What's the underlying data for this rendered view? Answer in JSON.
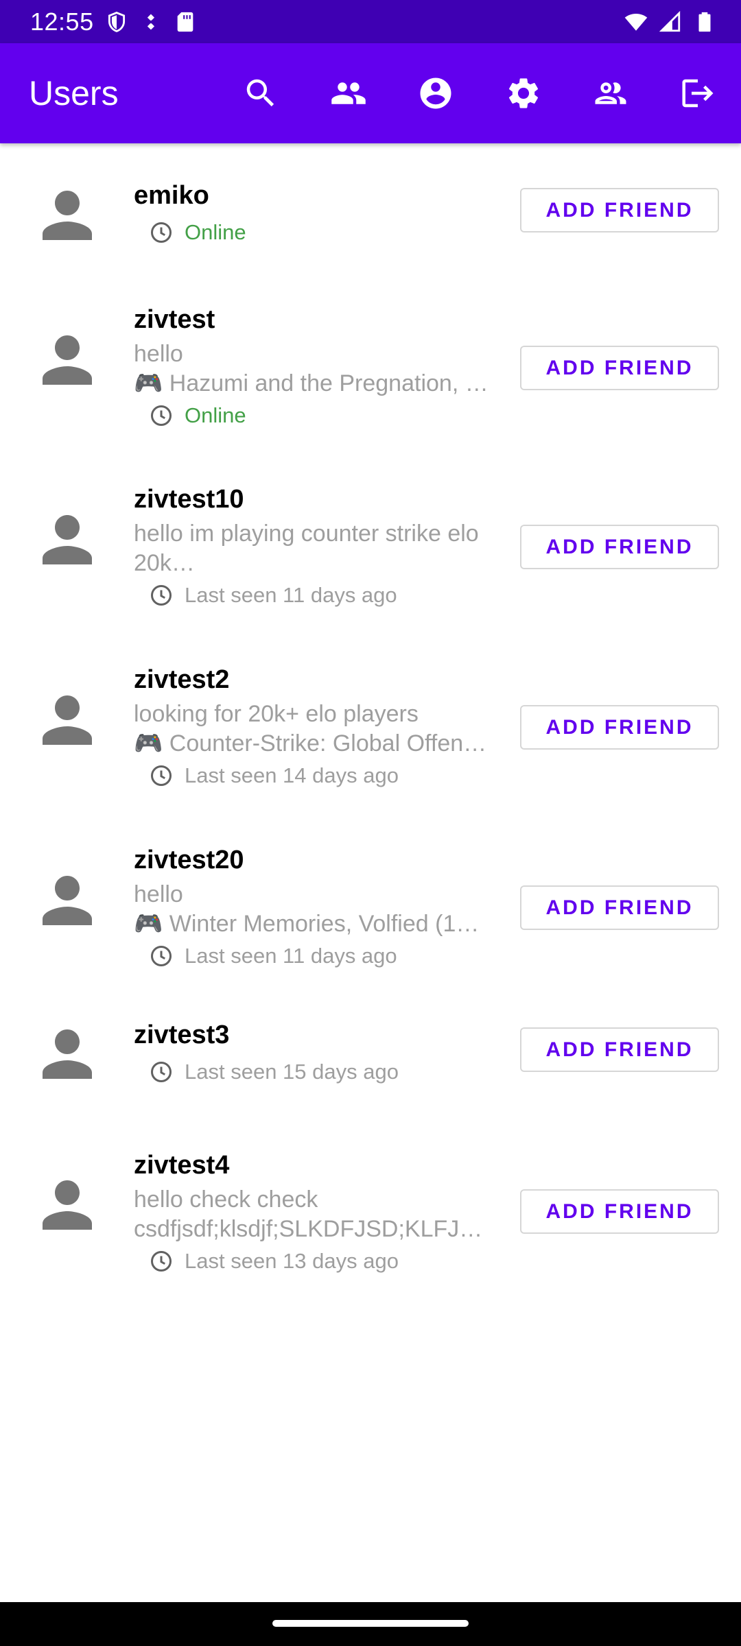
{
  "status_bar": {
    "time": "12:55",
    "left_icons": [
      "shield-icon",
      "data-saver-icon",
      "sd-card-icon"
    ],
    "right_icons": [
      "wifi-icon",
      "signal-icon",
      "battery-icon"
    ]
  },
  "app_bar": {
    "title": "Users",
    "actions": [
      "search-icon",
      "people-icon",
      "account-circle-icon",
      "settings-icon",
      "group-outline-icon",
      "logout-icon"
    ]
  },
  "colors": {
    "app_bar": "#6200ee",
    "status_bar": "#3f00b3",
    "online": "#43a047",
    "muted": "#9e9e9e",
    "avatar": "#757575"
  },
  "users": [
    {
      "name": "emiko",
      "bio": "",
      "game": "",
      "status": "Online",
      "online": true,
      "button": "ADD FRIEND"
    },
    {
      "name": "zivtest",
      "bio": "hello",
      "game": "🎮 Hazumi and the Pregnation, …",
      "status": "Online",
      "online": true,
      "button": "ADD FRIEND"
    },
    {
      "name": "zivtest10",
      "bio": "hello im playing counter strike elo 20k…",
      "game": "",
      "status": "Last seen 11 days ago",
      "online": false,
      "button": "ADD FRIEND"
    },
    {
      "name": "zivtest2",
      "bio": "looking for 20k+ elo players",
      "game": "🎮 Counter-Strike: Global Offen…",
      "status": "Last seen 14 days ago",
      "online": false,
      "button": "ADD FRIEND"
    },
    {
      "name": "zivtest20",
      "bio": "hello",
      "game": "🎮 Winter Memories, Volfied (1…",
      "status": "Last seen 11 days ago",
      "online": false,
      "button": "ADD FRIEND"
    },
    {
      "name": "zivtest3",
      "bio": "",
      "game": "",
      "status": "Last seen 15 days ago",
      "online": false,
      "button": "ADD FRIEND"
    },
    {
      "name": "zivtest4",
      "bio": "hello check check csdfjsdf;klsdjf;SLKDFJSD;KLFJ…",
      "game": "",
      "status": "Last seen 13 days ago",
      "online": false,
      "button": "ADD FRIEND"
    }
  ]
}
